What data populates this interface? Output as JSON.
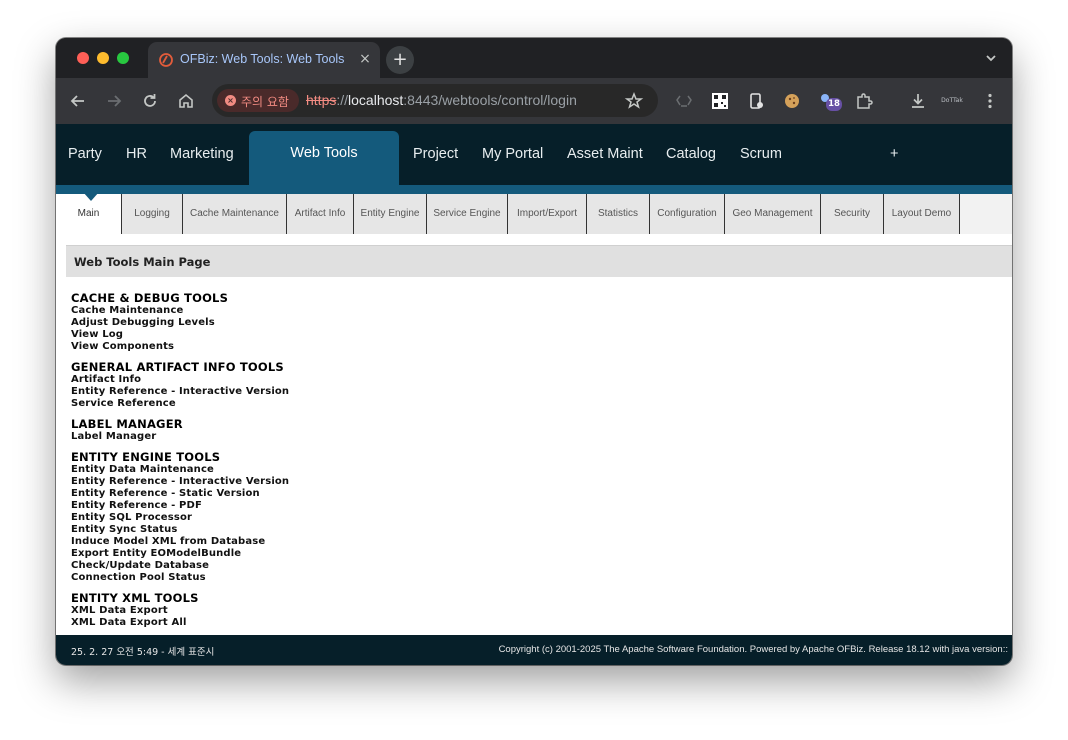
{
  "browser": {
    "tab_title": "OFBiz: Web Tools: Web Tools",
    "tab_close": "×",
    "new_tab": "+",
    "security_chip": "주의 요함",
    "url_scheme": "https",
    "url_sep": "://",
    "url_host": "localhost",
    "url_rest": ":8443/webtools/control/login",
    "extension_badge": "18",
    "dottak_label": "DoTTak"
  },
  "app_nav": {
    "items": [
      "Party",
      "HR",
      "Marketing",
      "Project",
      "My Portal",
      "Asset Maint",
      "Catalog",
      "Scrum"
    ],
    "active": "Web Tools",
    "add": "+"
  },
  "sub_nav": {
    "tabs": [
      "Main",
      "Logging",
      "Cache Maintenance",
      "Artifact Info",
      "Entity Engine",
      "Service Engine",
      "Import/Export",
      "Statistics",
      "Configuration",
      "Geo Management",
      "Security",
      "Layout Demo"
    ]
  },
  "panel": {
    "title": "Web Tools Main Page"
  },
  "sections": [
    {
      "title": "CACHE & DEBUG TOOLS",
      "links": [
        "Cache Maintenance",
        "Adjust Debugging Levels",
        "View Log",
        "View Components"
      ]
    },
    {
      "title": "GENERAL ARTIFACT INFO TOOLS",
      "links": [
        "Artifact Info",
        "Entity Reference - Interactive Version",
        "Service Reference"
      ]
    },
    {
      "title": "LABEL MANAGER",
      "links": [
        "Label Manager"
      ]
    },
    {
      "title": "ENTITY ENGINE TOOLS",
      "links": [
        "Entity Data Maintenance",
        "Entity Reference - Interactive Version",
        "Entity Reference - Static Version",
        "Entity Reference - PDF",
        "Entity SQL Processor",
        "Entity Sync Status",
        "Induce Model XML from Database",
        "Export Entity EOModelBundle",
        "Check/Update Database",
        "Connection Pool Status"
      ]
    },
    {
      "title": "ENTITY XML TOOLS",
      "links": [
        "XML Data Export",
        "XML Data Export All"
      ]
    }
  ],
  "footer": {
    "timestamp": "25. 2. 27 오전 5:49 - 세계 표준시",
    "copyright": "Copyright (c) 2001-2025 The Apache Software Foundation. Powered by Apache OFBiz. Release 18.12 with java version::"
  },
  "colors": {
    "nav_bg": "#061f29",
    "nav_active": "#145a7c",
    "chrome_bg": "#202124",
    "toolbar_bg": "#35363a",
    "warning": "#f28b82"
  }
}
